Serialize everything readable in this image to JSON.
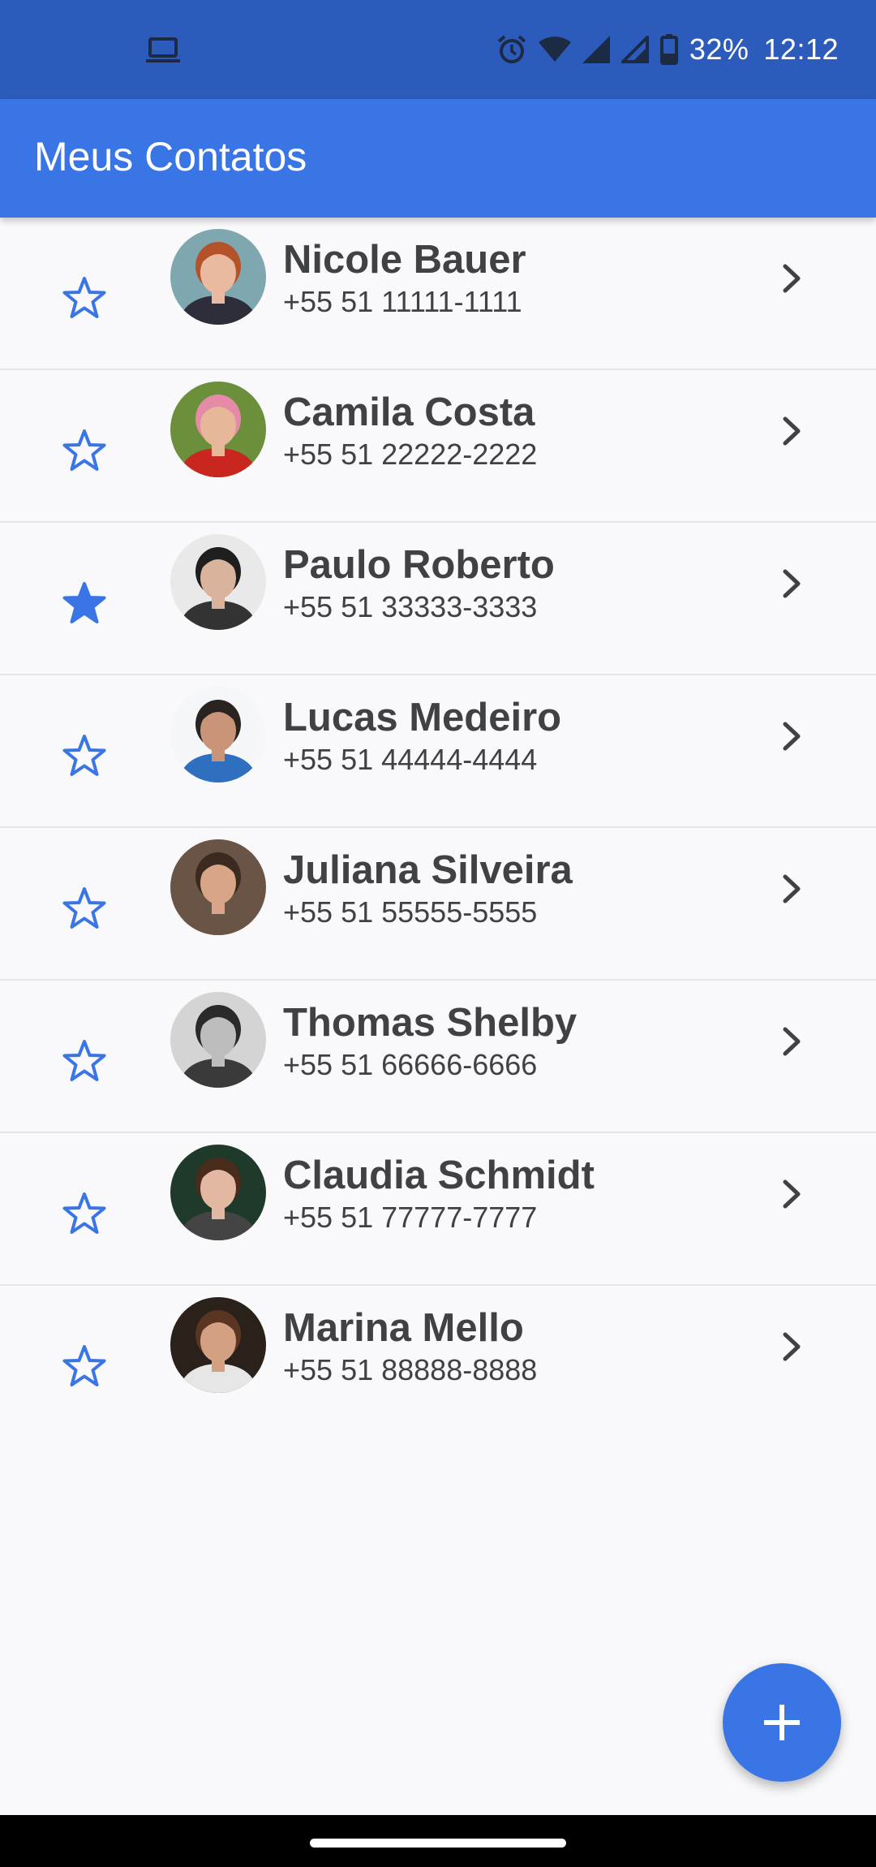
{
  "status_bar": {
    "battery": "32%",
    "time": "12:12",
    "icons": [
      "laptop-icon",
      "alarm-icon",
      "wifi-icon",
      "signal-icon",
      "signal-icon",
      "battery-icon"
    ]
  },
  "app_bar": {
    "title": "Meus Contatos"
  },
  "contacts": [
    {
      "name": "Nicole Bauer",
      "phone": "+55 51 11111-1111",
      "favorite": false
    },
    {
      "name": "Camila Costa",
      "phone": "+55 51 22222-2222",
      "favorite": false
    },
    {
      "name": "Paulo Roberto",
      "phone": "+55 51 33333-3333",
      "favorite": true
    },
    {
      "name": "Lucas Medeiro",
      "phone": "+55 51 44444-4444",
      "favorite": false
    },
    {
      "name": "Juliana Silveira",
      "phone": "+55 51 55555-5555",
      "favorite": false
    },
    {
      "name": "Thomas Shelby",
      "phone": "+55 51 66666-6666",
      "favorite": false
    },
    {
      "name": "Claudia Schmidt",
      "phone": "+55 51 77777-7777",
      "favorite": false
    },
    {
      "name": "Marina Mello",
      "phone": "+55 51 88888-8888",
      "favorite": false
    }
  ],
  "fab": {
    "icon": "plus-icon"
  },
  "colors": {
    "status_bar": "#2d5bbb",
    "primary": "#3a75e6",
    "text": "#3f4144",
    "background": "#f9f9fb",
    "divider": "#e6e6ea"
  }
}
